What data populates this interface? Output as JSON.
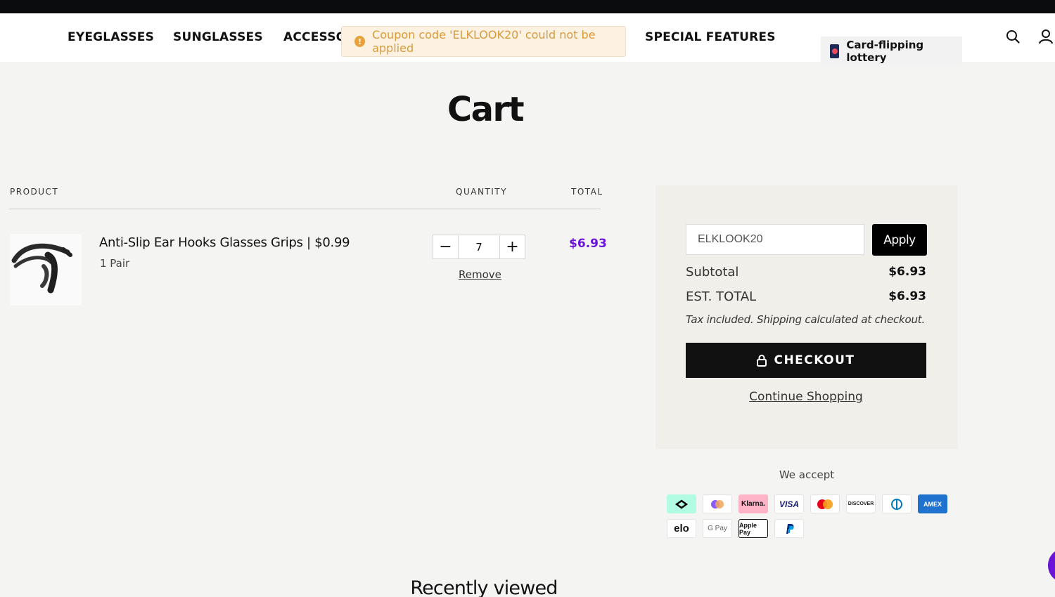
{
  "nav": {
    "items": [
      "EYEGLASSES",
      "SUNGLASSES",
      "ACCESSORIES",
      "SPECIAL FEATURES"
    ],
    "lottery_label": "Card-flipping lottery"
  },
  "toast": {
    "message": "Coupon code 'ELKLOOK20' could not be applied",
    "icon": "!"
  },
  "page": {
    "title": "Cart",
    "recently_viewed": "Recently viewed"
  },
  "table": {
    "headers": {
      "product": "PRODUCT",
      "quantity": "QUANTITY",
      "total": "TOTAL"
    }
  },
  "cart_item": {
    "title": "Anti-Slip Ear Hooks Glasses Grips",
    "price": "$0.99",
    "variant": "1 Pair",
    "quantity": "7",
    "minus": "−",
    "plus": "+",
    "remove_label": "Remove",
    "line_total": "$6.93"
  },
  "summary": {
    "coupon_value": "ELKLOOK20",
    "apply_label": "Apply",
    "subtotal_label": "Subtotal",
    "subtotal_value": "$6.93",
    "est_total_label": "EST. TOTAL",
    "est_total_value": "$6.93",
    "tax_note": "Tax included. Shipping calculated at checkout.",
    "checkout_label": "CHECKOUT",
    "continue_label": "Continue Shopping"
  },
  "payments": {
    "title": "We accept",
    "methods_row1": [
      "afterpay",
      "sezzle",
      "Klarna.",
      "VISA",
      "mastercard",
      "DISCOVER",
      "diners",
      "AMEX"
    ],
    "methods_row2": [
      "elo",
      "G Pay",
      "Apple Pay",
      "PayPal"
    ]
  },
  "colors": {
    "accent_purple": "#6b14d8",
    "toast_bg": "#fdf2e2",
    "toast_text": "#d99a3b",
    "summary_bg": "#f1efe9"
  }
}
